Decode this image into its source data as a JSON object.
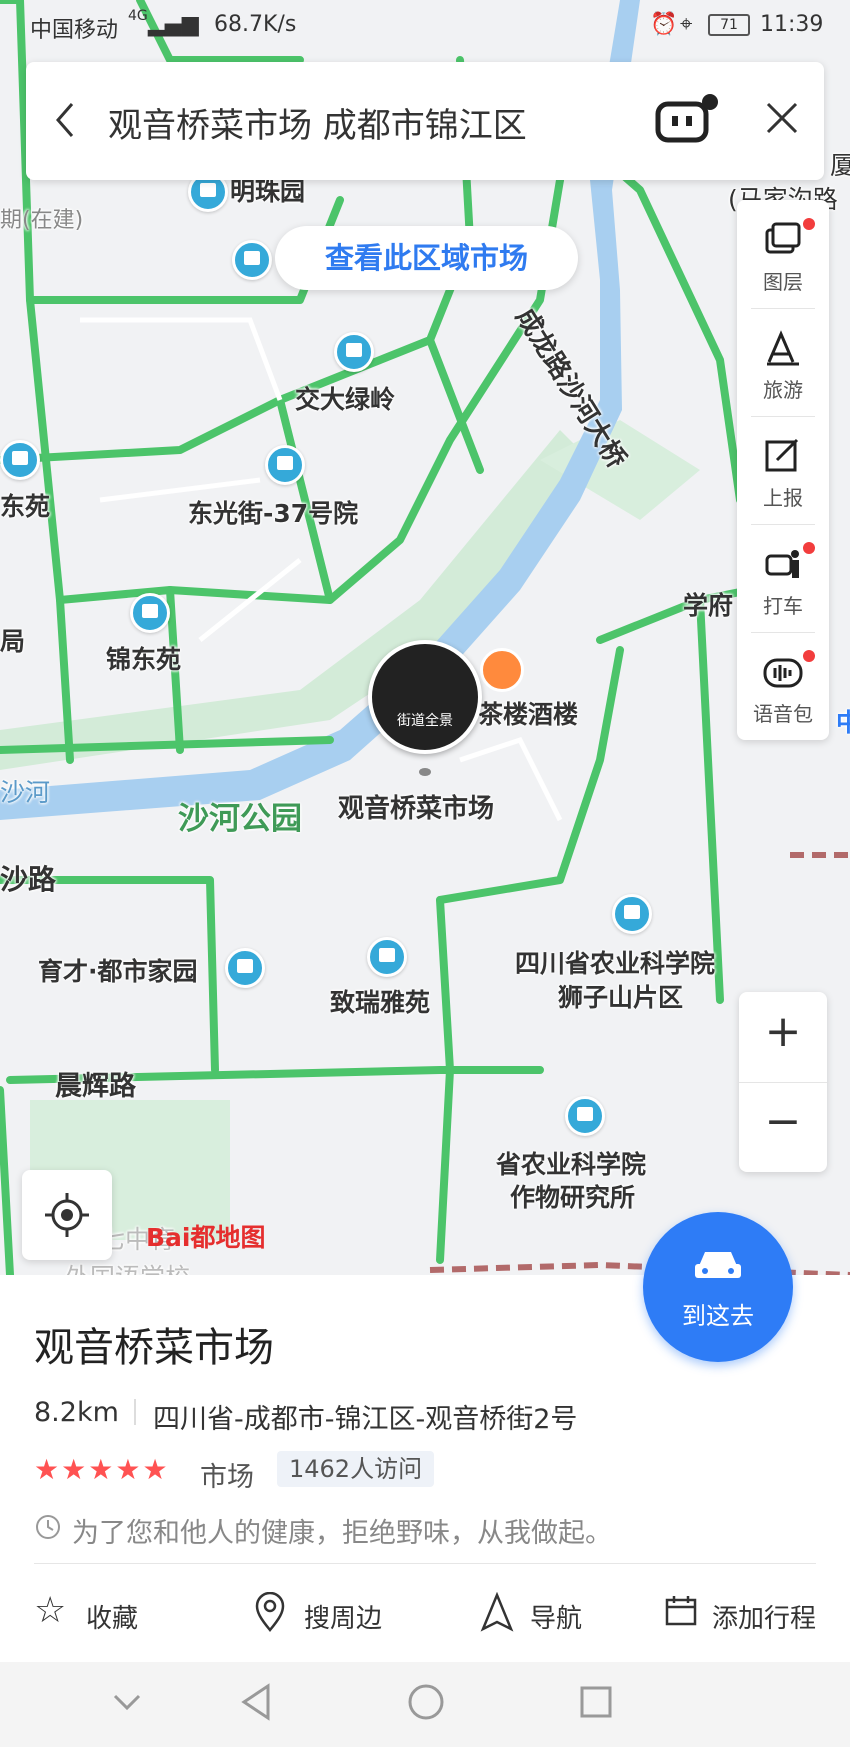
{
  "status_bar": {
    "carrier": "中国移动",
    "network": "4G",
    "speed": "68.7K/s",
    "battery": "71",
    "time": "11:39"
  },
  "search": {
    "query": "观音桥菜市场 成都市锦江区",
    "back_icon": "chevron-left-icon",
    "robot_icon": "robot-icon",
    "close_icon": "close-icon"
  },
  "map": {
    "area_button": "查看此区域市场",
    "labels": {
      "mingzhu": "明珠园",
      "jiaoda": "交大绿岭",
      "dongguang": "东光街-37号院",
      "dongyuan": "东苑",
      "jindong": "锦东苑",
      "ju": "局",
      "sha_river": "沙河",
      "shahe_park": "沙河公园",
      "target": "观音桥菜市场",
      "restaurant": "茶楼酒楼",
      "shalu": "沙路",
      "yucai": "育才·都市家园",
      "zhirui": "致瑞雅苑",
      "sichuan_acad": "四川省农业科学院",
      "sichuan_acad2": "狮子山片区",
      "chenghui": "晨辉路",
      "crop_inst": "省农业科学院",
      "crop_inst2": "作物研究所",
      "xuefu": "学府",
      "road_bridge": "成龙路沙河大桥",
      "majia": "(马家沟路",
      "xia": "厦",
      "construct": "期(在建)",
      "zhong": "中",
      "qi": "七中育",
      "waiguo": "外国语学校"
    },
    "street_view": "街道全景",
    "logo": "Bai都地图"
  },
  "toolbar": {
    "items": [
      {
        "label": "图层",
        "icon": "layers-icon",
        "dot": true
      },
      {
        "label": "旅游",
        "icon": "travel-icon",
        "dot": false
      },
      {
        "label": "上报",
        "icon": "report-icon",
        "dot": false
      },
      {
        "label": "打车",
        "icon": "taxi-icon",
        "dot": true
      },
      {
        "label": "语音包",
        "icon": "voice-pack-icon",
        "dot": true
      }
    ]
  },
  "zoom": {
    "in": "+",
    "out": "−"
  },
  "place": {
    "name": "观音桥菜市场",
    "distance": "8.2km",
    "address": "四川省-成都市-锦江区-观音桥街2号",
    "rating_stars": 5,
    "category": "市场",
    "visits": "1462人访问",
    "notice": "为了您和他人的健康，拒绝野味，从我做起。"
  },
  "goto_button": "到这去",
  "actions": {
    "favorite": "收藏",
    "nearby": "搜周边",
    "navigate": "导航",
    "add_trip": "添加行程"
  },
  "colors": {
    "accent": "#2e7cf6",
    "road_green": "#4cc46a",
    "river": "#9ec9ee",
    "park": "#cfead3",
    "star": "#ff5252"
  }
}
